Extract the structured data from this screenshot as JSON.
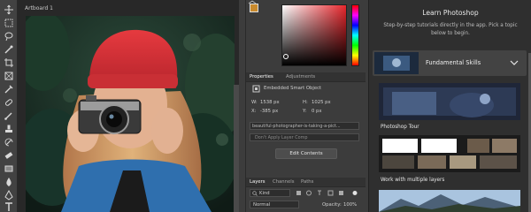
{
  "canvas": {
    "artboard_label": "Artboard 1"
  },
  "properties_panel": {
    "tabs": [
      "Properties",
      "Adjustments"
    ],
    "layer_type": "Embedded Smart Object",
    "width_label": "W:",
    "width_value": "1538 px",
    "height_label": "H:",
    "height_value": "1025 px",
    "x_label": "X:",
    "x_value": "-385 px",
    "y_label": "Y:",
    "y_value": "0 px",
    "filename": "beautiful-photographer-is-taking-a-pict...",
    "layer_comps": "Don't Apply Layer Comp",
    "edit_button": "Edit Contents"
  },
  "layers_panel": {
    "tabs": [
      "Layers",
      "Channels",
      "Paths"
    ],
    "filter_label": "Kind",
    "blend_mode": "Normal",
    "opacity_label": "Opacity:",
    "opacity_value": "100%"
  },
  "learn_panel": {
    "title": "Learn Photoshop",
    "description": "Step-by-step tutorials directly in the app. Pick a topic below to begin.",
    "section": "Fundamental Skills",
    "tutorials": [
      {
        "label": "Photoshop Tour"
      },
      {
        "label": "Work with multiple layers"
      }
    ]
  },
  "colors": {
    "foreground": "#c98a2d",
    "background": "#ffffff",
    "picker_hue": "#e8262c",
    "accent": "#1473e6"
  }
}
